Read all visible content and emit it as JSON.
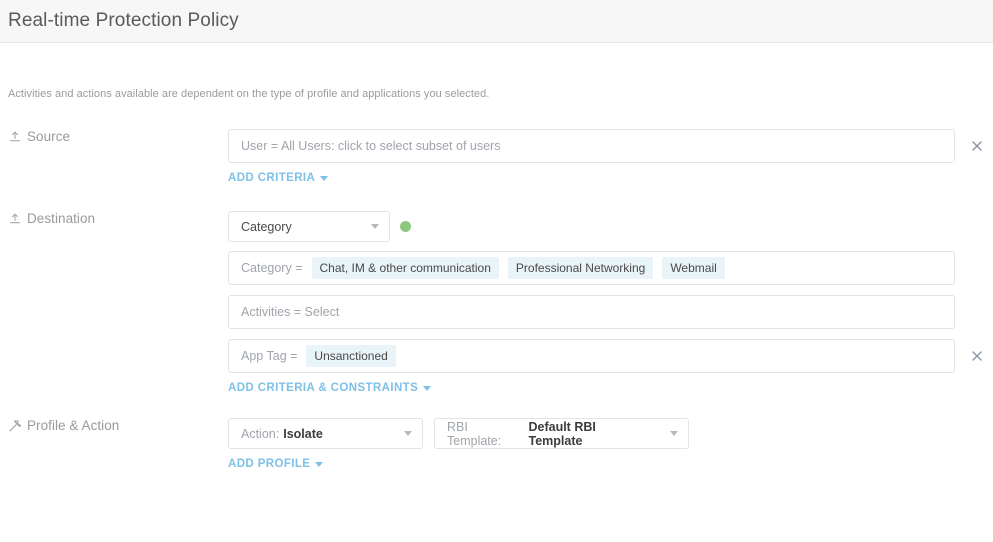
{
  "header": {
    "title": "Real-time Protection Policy"
  },
  "description": "Activities and actions available are dependent on the type of profile and applications you selected.",
  "sections": {
    "source": {
      "label": "Source",
      "icon": "source-upload-icon",
      "field": {
        "text": "User = All Users: click to select subset of users"
      },
      "close_icon": "close-icon",
      "add_link": "ADD CRITERIA"
    },
    "destination": {
      "label": "Destination",
      "icon": "destination-upload-icon",
      "type_select": {
        "value": "Category",
        "status_dot_color": "#8cc97f",
        "status_dot_name": "status-dot-green"
      },
      "rows": [
        {
          "name": "category-row",
          "prefix": "Category =",
          "chips": [
            "Chat, IM & other communication",
            "Professional Networking",
            "Webmail"
          ],
          "has_close": false
        },
        {
          "name": "activities-row",
          "prefix": "Activities = Select",
          "chips": [],
          "has_close": false
        },
        {
          "name": "app-tag-row",
          "prefix": "App Tag =",
          "chips": [
            "Unsanctioned"
          ],
          "has_close": true
        }
      ],
      "close_icon": "close-icon",
      "add_link": "ADD CRITERIA & CONSTRAINTS"
    },
    "profile_action": {
      "label": "Profile & Action",
      "icon": "gavel-icon",
      "action_select": {
        "prefix": "Action:",
        "value": "Isolate"
      },
      "rbi_select": {
        "prefix": "RBI Template:",
        "value": "Default RBI Template"
      },
      "add_link": "ADD PROFILE"
    }
  },
  "colors": {
    "accent_link": "#7ec0e8",
    "chip_bg": "#e8f4f7",
    "status_green": "#8cc97f",
    "header_bg": "#f7f7f7"
  }
}
